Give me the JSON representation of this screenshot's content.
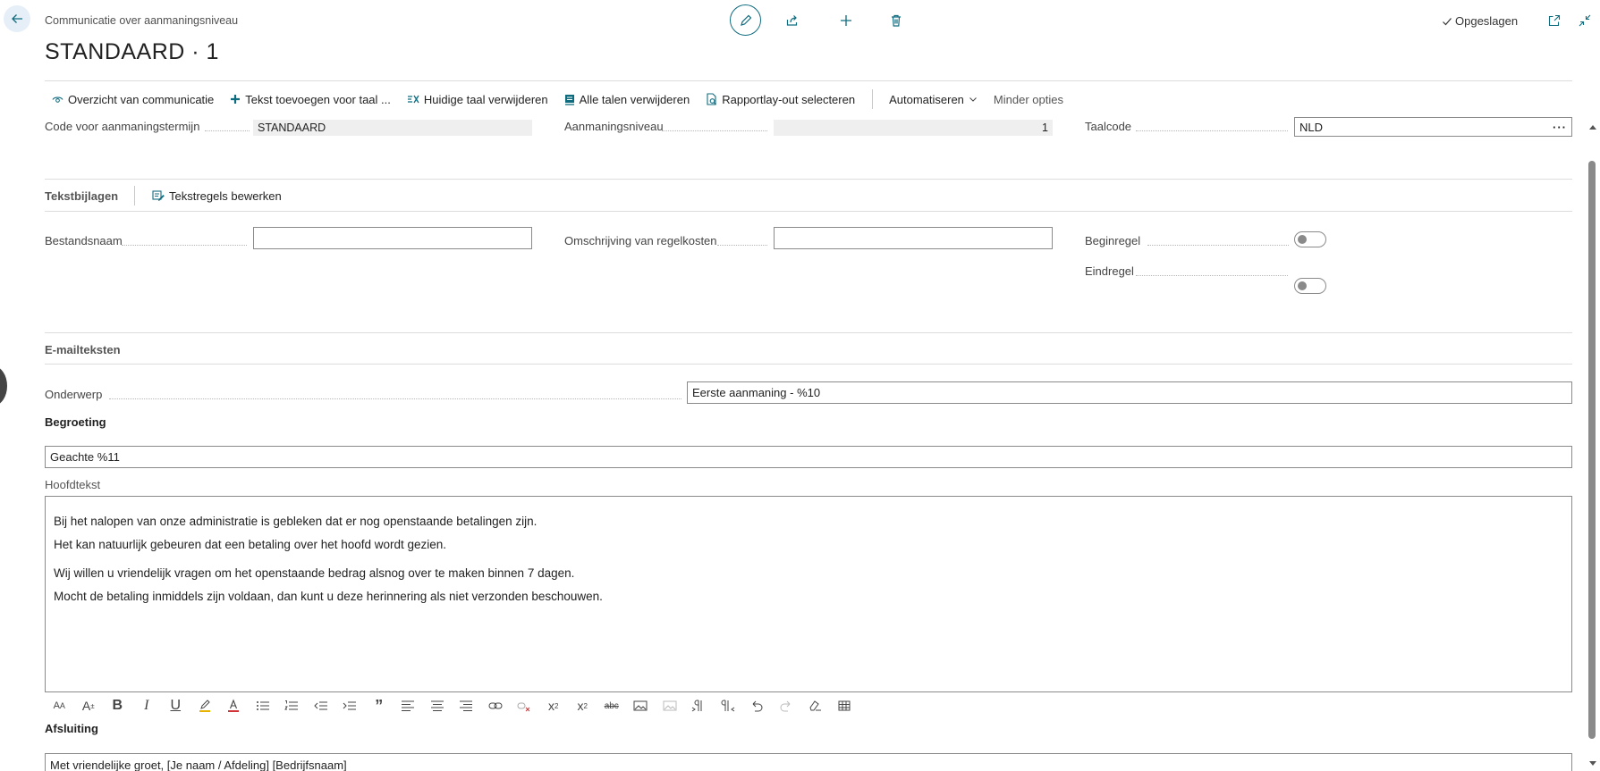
{
  "header": {
    "breadcrumb": "Communicatie over aanmaningsniveau",
    "title": "STANDAARD · 1",
    "status": "Opgeslagen"
  },
  "actions": [
    {
      "label": "Overzicht van communicatie",
      "icon": "eye-icon"
    },
    {
      "label": "Tekst toevoegen voor taal ...",
      "icon": "plus-icon"
    },
    {
      "label": "Huidige taal verwijderen",
      "icon": "remove-language-icon"
    },
    {
      "label": "Alle talen verwijderen",
      "icon": "delete-all-icon"
    },
    {
      "label": "Rapportlay-out selecteren",
      "icon": "report-layout-icon"
    },
    {
      "label": "Automatiseren",
      "icon": "chevron-down-icon"
    },
    {
      "label": "Minder opties"
    }
  ],
  "general": {
    "code_label": "Code voor aanmaningstermijn",
    "code_value": "STANDAARD",
    "level_label": "Aanmaningsniveau",
    "level_value": "1",
    "lang_label": "Taalcode",
    "lang_value": "NLD"
  },
  "attachments": {
    "title": "Tekstbijlagen",
    "edit_action": "Tekstregels bewerken",
    "filename_label": "Bestandsnaam",
    "filename_value": "",
    "costs_label": "Omschrijving van regelkosten",
    "costs_value": "",
    "begin_label": "Beginregel",
    "end_label": "Eindregel"
  },
  "email": {
    "title": "E-mailteksten",
    "subject_label": "Onderwerp",
    "subject_value": "Eerste aanmaning - %10",
    "greeting_label": "Begroeting",
    "greeting_value": "Geachte %11",
    "body_label": "Hoofdtekst",
    "body_lines": [
      "Bij het nalopen van onze administratie is gebleken dat er nog openstaande betalingen zijn.",
      "Het kan natuurlijk gebeuren dat een betaling over het hoofd wordt gezien.",
      "Wij willen u vriendelijk vragen om het openstaande bedrag alsnog over te maken binnen 7 dagen.",
      "Mocht de betaling inmiddels zijn voldaan, dan kunt u deze herinnering als niet verzonden beschouwen."
    ],
    "closing_label": "Afsluiting",
    "closing_value": "Met vriendelijke groet, [Je naam / Afdeling] [Bedrijfsnaam]"
  },
  "colors": {
    "accent": "#0f6c7f",
    "text": "#212121",
    "readonly_bg": "#efefef"
  }
}
